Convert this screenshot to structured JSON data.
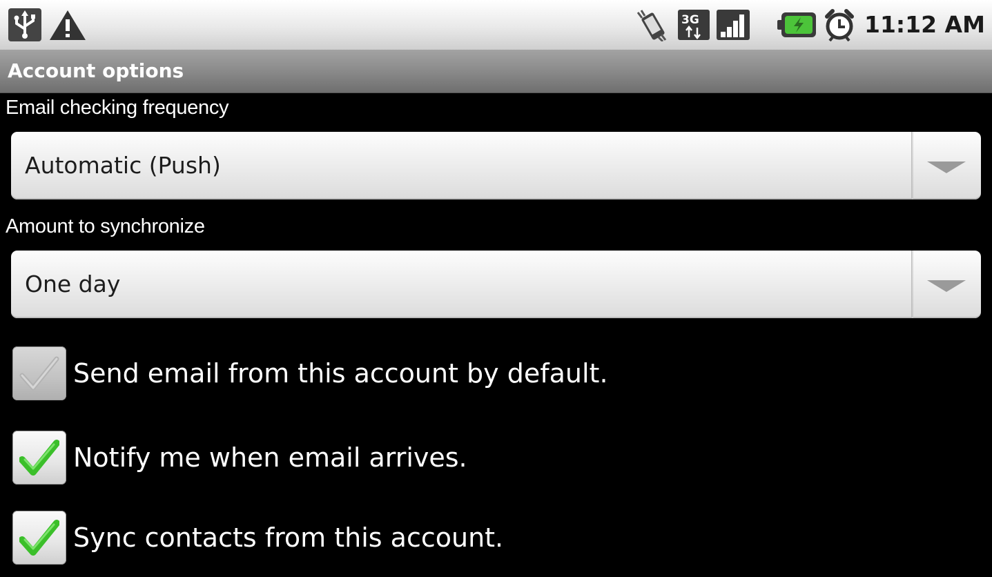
{
  "status_bar": {
    "time": "11:12 AM",
    "icons": [
      "usb-icon",
      "warning-icon",
      "vibrate-icon",
      "3g-icon",
      "signal-icon",
      "battery-charging-icon",
      "alarm-icon"
    ]
  },
  "title_bar": {
    "title": "Account options"
  },
  "settings": {
    "frequency": {
      "label": "Email checking frequency",
      "value": "Automatic (Push)"
    },
    "sync_amount": {
      "label": "Amount to synchronize",
      "value": "One day"
    },
    "checkboxes": [
      {
        "label": "Send email from this account by default.",
        "checked": true,
        "enabled": false
      },
      {
        "label": "Notify me when email arrives.",
        "checked": true,
        "enabled": true
      },
      {
        "label": "Sync contacts from this account.",
        "checked": true,
        "enabled": true
      }
    ]
  },
  "colors": {
    "check_green": "#3bbf2a",
    "check_gray": "#b3b3b3",
    "battery_green": "#4cc43a"
  }
}
